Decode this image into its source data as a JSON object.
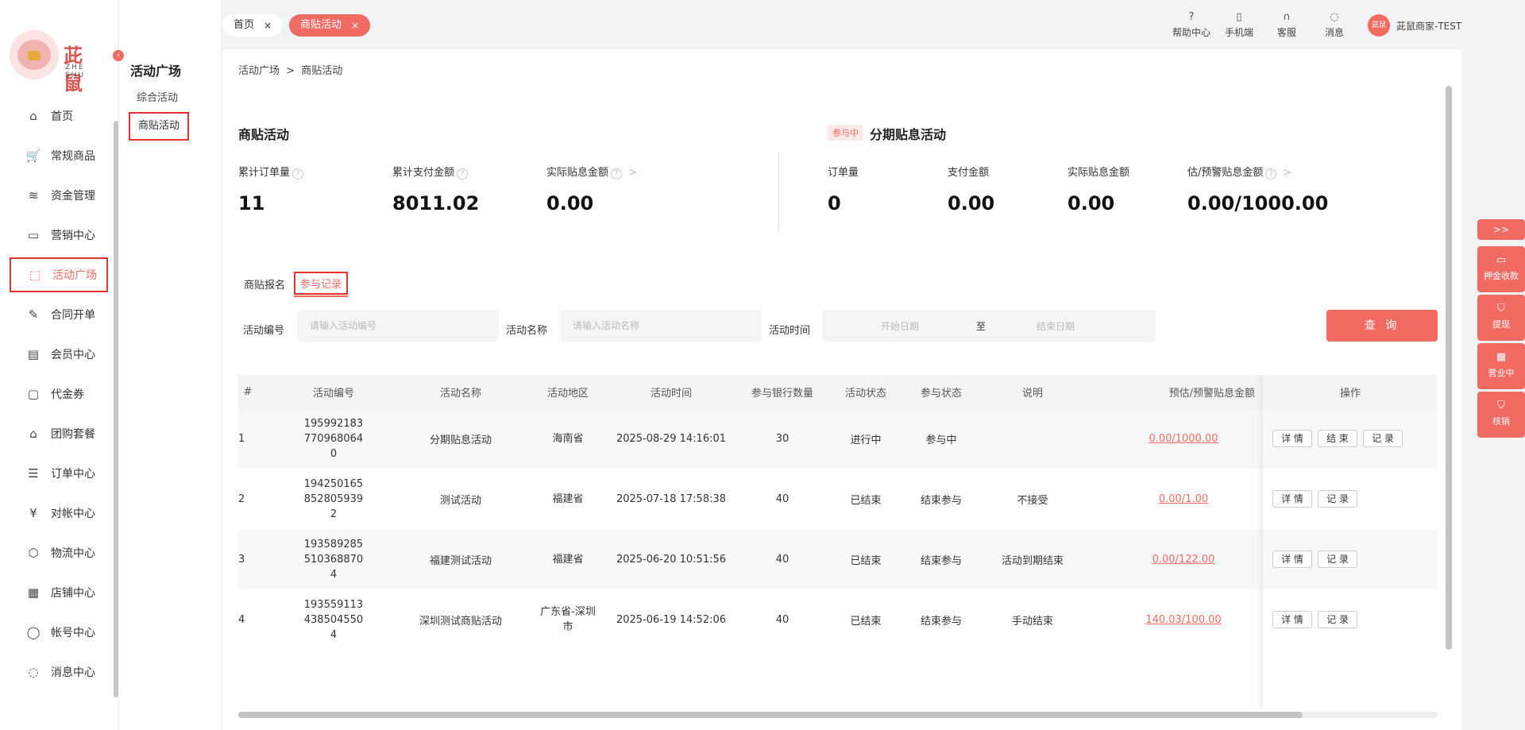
{
  "brand": {
    "name": "茈鼠",
    "sub": "ZHE SHU"
  },
  "nav": [
    {
      "label": "首页",
      "icon": "home-icon",
      "glyph": "⌂"
    },
    {
      "label": "常规商品",
      "icon": "cart-icon",
      "glyph": "🛒"
    },
    {
      "label": "资金管理",
      "icon": "layers-icon",
      "glyph": "≋"
    },
    {
      "label": "营销中心",
      "icon": "camera-icon",
      "glyph": "▭"
    },
    {
      "label": "活动广场",
      "icon": "box-icon",
      "glyph": "⬚"
    },
    {
      "label": "合同开单",
      "icon": "contract-icon",
      "glyph": "✎"
    },
    {
      "label": "会员中心",
      "icon": "vip-icon",
      "glyph": "▤"
    },
    {
      "label": "代金券",
      "icon": "voucher-icon",
      "glyph": "▢"
    },
    {
      "label": "团购套餐",
      "icon": "bag-icon",
      "glyph": "⌂"
    },
    {
      "label": "订单中心",
      "icon": "order-icon",
      "glyph": "☰"
    },
    {
      "label": "对帐中心",
      "icon": "yen-icon",
      "glyph": "¥"
    },
    {
      "label": "物流中心",
      "icon": "package-icon",
      "glyph": "⬡"
    },
    {
      "label": "店铺中心",
      "icon": "shop-icon",
      "glyph": "▦"
    },
    {
      "label": "帐号中心",
      "icon": "user-icon",
      "glyph": "◯"
    },
    {
      "label": "消息中心",
      "icon": "message-icon",
      "glyph": "◌"
    }
  ],
  "subnav": {
    "title": "活动广场",
    "items": [
      "综合活动",
      "商贴活动"
    ]
  },
  "tabs": [
    {
      "label": "首页",
      "close": "×"
    },
    {
      "label": "商贴活动",
      "close": "×"
    }
  ],
  "toolbar": [
    {
      "label": "帮助中心",
      "icon": "help-icon",
      "glyph": "?"
    },
    {
      "label": "手机端",
      "icon": "phone-icon",
      "glyph": "▯"
    },
    {
      "label": "客服",
      "icon": "headset-icon",
      "glyph": "∩"
    },
    {
      "label": "消息",
      "icon": "chat-icon",
      "glyph": "◌"
    }
  ],
  "user": {
    "name": "茈鼠商家-TEST",
    "avatar_text": "茈鼠"
  },
  "breadcrumb": {
    "parent": "活动广场",
    "sep": ">",
    "current": "商贴活动"
  },
  "stats_left": {
    "title": "商贴活动",
    "items": [
      {
        "label": "累计订单量",
        "value": "11"
      },
      {
        "label": "累计支付金额",
        "value": "8011.02"
      },
      {
        "label": "实际贴息金额",
        "value": "0.00",
        "more": ">"
      }
    ]
  },
  "stats_right": {
    "badge": "参与中",
    "title": "分期贴息活动",
    "items": [
      {
        "label": "订单量",
        "value": "0"
      },
      {
        "label": "支付金额",
        "value": "0.00"
      },
      {
        "label": "实际贴息金额",
        "value": "0.00"
      },
      {
        "label": "估/预警贴息金额",
        "value": "0.00/1000.00",
        "more": ">"
      }
    ]
  },
  "list_tabs": [
    "商贴报名",
    "参与记录"
  ],
  "filters": {
    "code_label": "活动编号",
    "code_placeholder": "请输入活动编号",
    "name_label": "活动名称",
    "name_placeholder": "请输入活动名称",
    "time_label": "活动时间",
    "start_placeholder": "开始日期",
    "range_sep": "至",
    "end_placeholder": "结束日期",
    "query_label": "查 询"
  },
  "table": {
    "headers": [
      "#",
      "活动编号",
      "活动名称",
      "活动地区",
      "活动时间",
      "参与银行数量",
      "活动状态",
      "参与状态",
      "说明",
      "预估/预警贴息金额",
      "操作"
    ],
    "rows": [
      {
        "idx": "1",
        "code": "1959921837709680640",
        "name": "分期贴息活动",
        "region": "海南省",
        "time": "2025-08-29 14:16:01",
        "banks": "30",
        "status": "进行中",
        "join": "参与中",
        "note": "",
        "amount": "0.00/1000.00",
        "ops": [
          "详 情",
          "结 束",
          "记 录"
        ]
      },
      {
        "idx": "2",
        "code": "1942501658528059392",
        "name": "测试活动",
        "region": "福建省",
        "time": "2025-07-18 17:58:38",
        "banks": "40",
        "status": "已结束",
        "join": "结束参与",
        "note": "不接受",
        "amount": "0.00/1.00",
        "ops": [
          "详 情",
          "记 录"
        ]
      },
      {
        "idx": "3",
        "code": "1935892855103688704",
        "name": "福建测试活动",
        "region": "福建省",
        "time": "2025-06-20 10:51:56",
        "banks": "40",
        "status": "已结束",
        "join": "结束参与",
        "note": "活动到期结束",
        "amount": "0.00/122.00",
        "ops": [
          "详 情",
          "记 录"
        ]
      },
      {
        "idx": "4",
        "code": "1935591134385045504",
        "name": "深圳测试商贴活动",
        "region": "广东省-深圳市",
        "time": "2025-06-19 14:52:06",
        "banks": "40",
        "status": "已结束",
        "join": "结束参与",
        "note": "手动结束",
        "amount": "140.03/100.00",
        "ops": [
          "详 情",
          "记 录"
        ]
      }
    ]
  },
  "float_panel": {
    "toggle": ">>",
    "items": [
      {
        "label": "押金收款",
        "icon": "wallet-icon",
        "glyph": "▭"
      },
      {
        "label": "提现",
        "icon": "withdraw-icon",
        "glyph": "⛉"
      },
      {
        "label": "营业中",
        "icon": "store-icon",
        "glyph": "▦"
      },
      {
        "label": "核销",
        "icon": "verify-icon",
        "glyph": "⛉"
      }
    ]
  },
  "colors": {
    "accent": "#f26b63",
    "highlight_border": "#e8322c"
  }
}
